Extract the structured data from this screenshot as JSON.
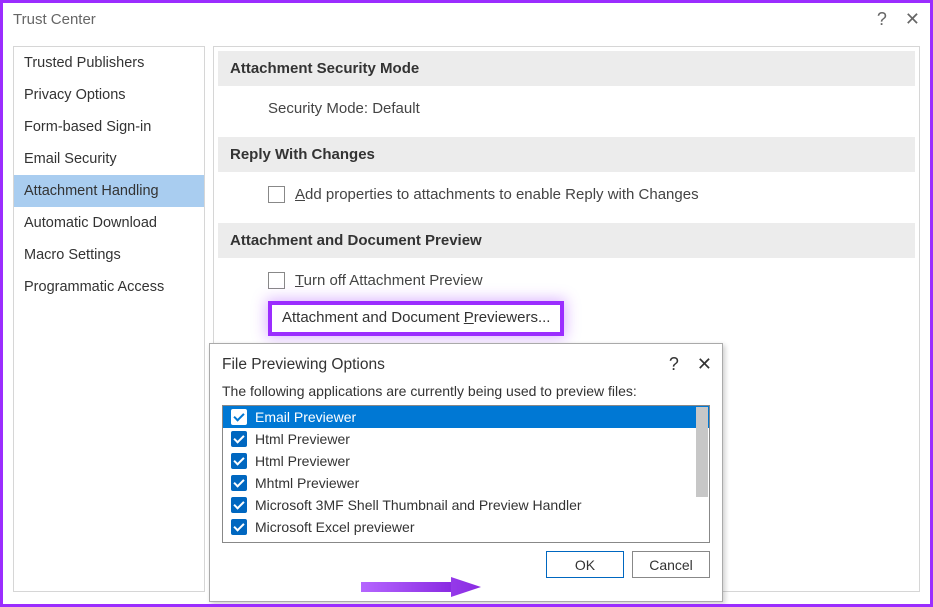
{
  "window": {
    "title": "Trust Center"
  },
  "sidebar": {
    "items": [
      {
        "label": "Trusted Publishers"
      },
      {
        "label": "Privacy Options"
      },
      {
        "label": "Form-based Sign-in"
      },
      {
        "label": "Email Security"
      },
      {
        "label": "Attachment Handling"
      },
      {
        "label": "Automatic Download"
      },
      {
        "label": "Macro Settings"
      },
      {
        "label": "Programmatic Access"
      }
    ],
    "selected_index": 4
  },
  "main": {
    "section1": {
      "title": "Attachment Security Mode",
      "body": "Security Mode: Default"
    },
    "section2": {
      "title": "Reply With Changes",
      "checkbox_prefix": "A",
      "checkbox_rest": "dd properties to attachments to enable Reply with Changes"
    },
    "section3": {
      "title": "Attachment and Document Preview",
      "checkbox_prefix": "T",
      "checkbox_rest": "urn off Attachment Preview",
      "button_pre": "Attachment and Document ",
      "button_u": "P",
      "button_post": "reviewers..."
    }
  },
  "modal": {
    "title": "File Previewing Options",
    "desc": "The following applications are currently being used to preview files:",
    "items": [
      {
        "label": "Email Previewer",
        "selected": true
      },
      {
        "label": "Html Previewer"
      },
      {
        "label": "Html Previewer"
      },
      {
        "label": "Mhtml Previewer"
      },
      {
        "label": "Microsoft 3MF Shell Thumbnail and Preview Handler"
      },
      {
        "label": "Microsoft Excel previewer"
      }
    ],
    "ok": "OK",
    "cancel": "Cancel"
  }
}
